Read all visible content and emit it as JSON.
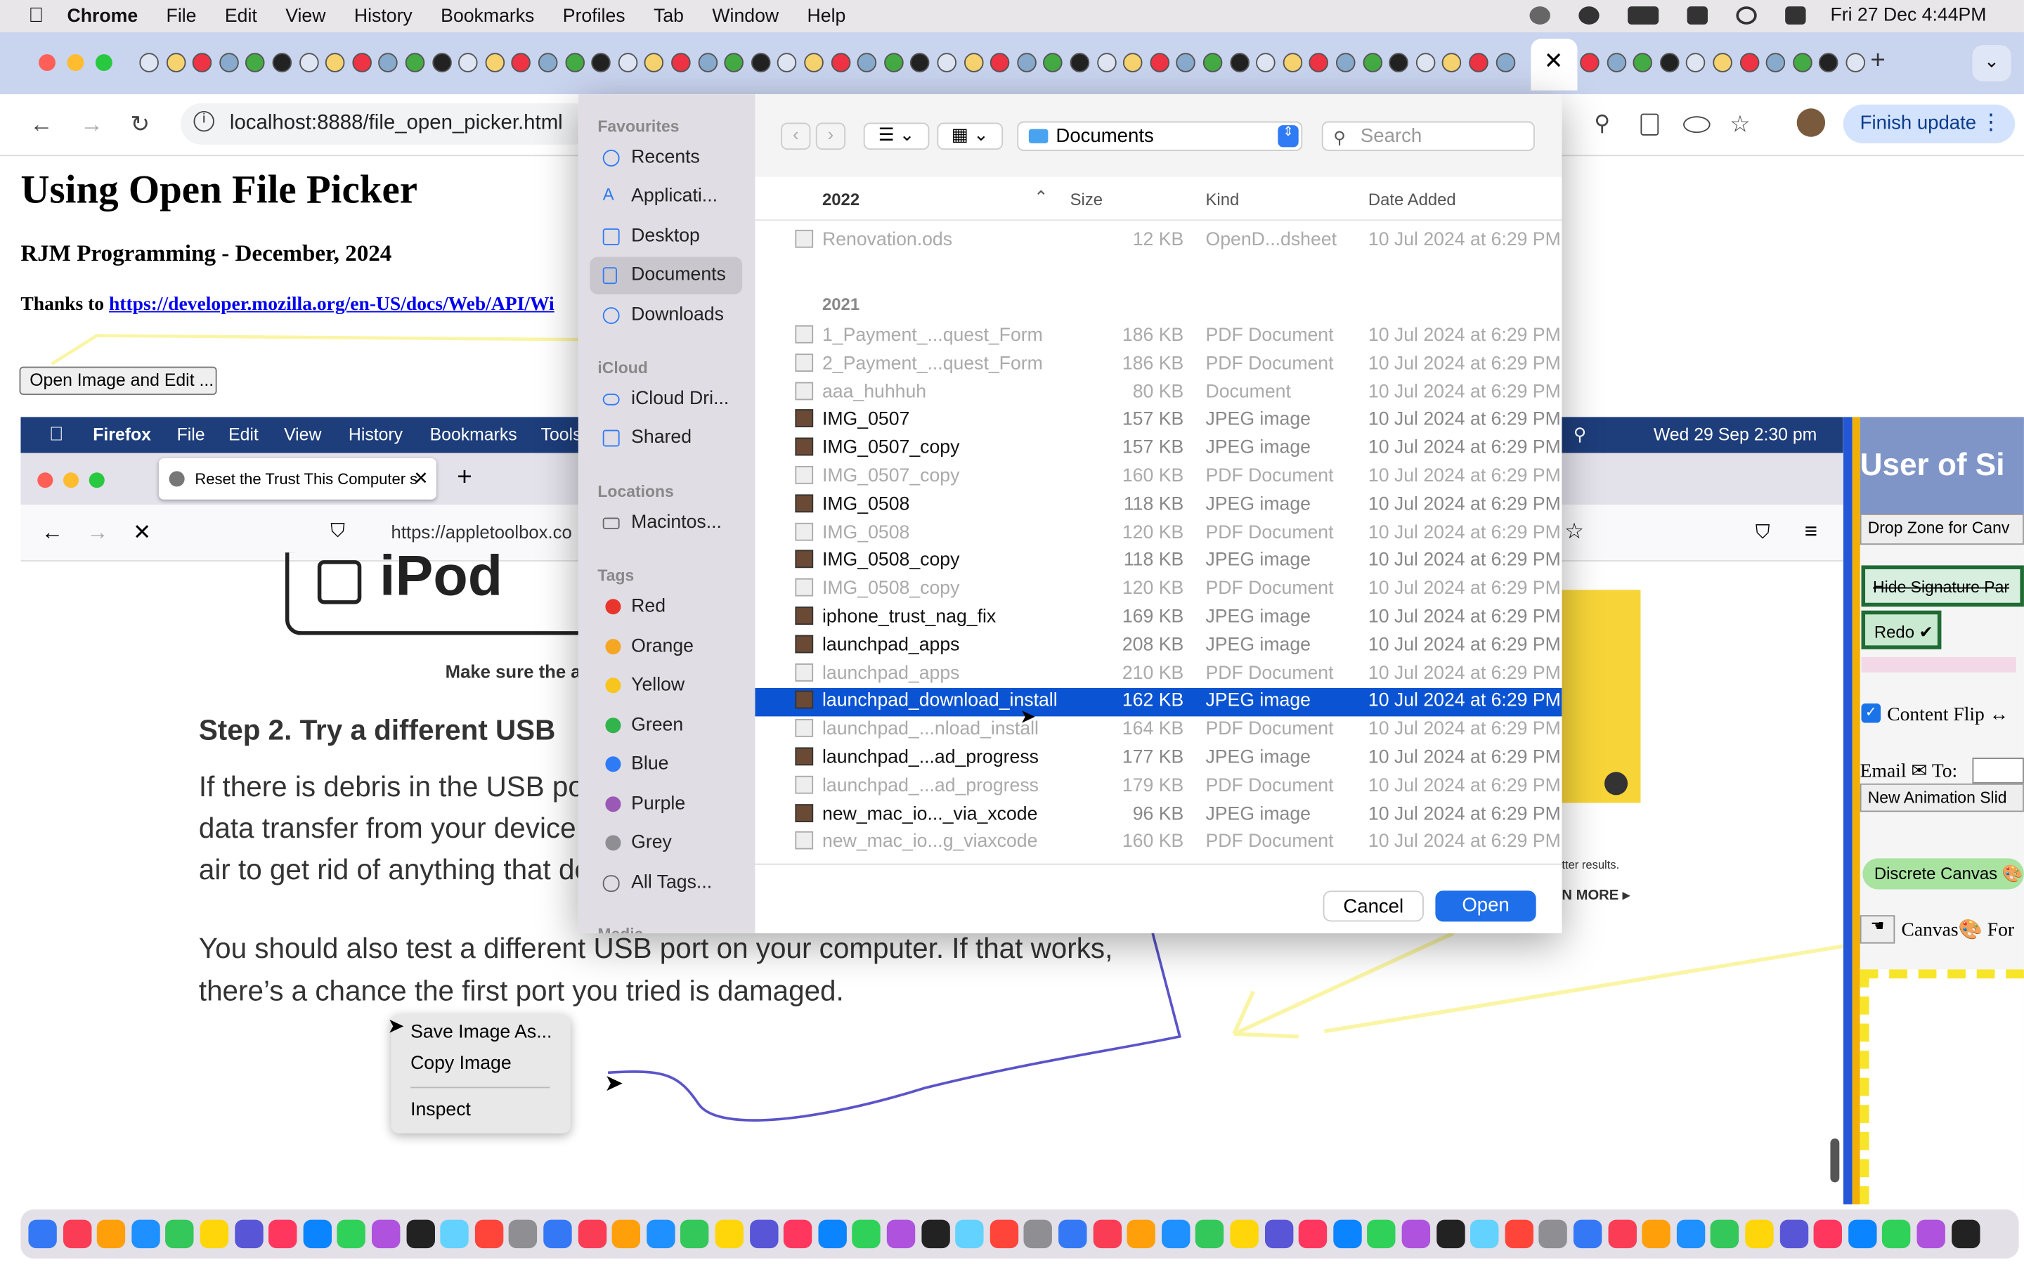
{
  "menubar": {
    "app": "Chrome",
    "items": [
      "File",
      "Edit",
      "View",
      "History",
      "Bookmarks",
      "Profiles",
      "Tab",
      "Window",
      "Help"
    ],
    "datetime": "Fri 27 Dec  4:44PM"
  },
  "browser": {
    "url": "localhost:8888/file_open_picker.html",
    "finish_update": "Finish update"
  },
  "page": {
    "title": "Using Open File Picker",
    "subtitle": "RJM Programming - December, 2024",
    "thanks_prefix": "Thanks to ",
    "thanks_link": "https://developer.mozilla.org/en-US/docs/Web/API/Wi",
    "open_button": "Open Image and Edit ..."
  },
  "embedded": {
    "menubar": {
      "app": "Firefox",
      "items": [
        "File",
        "Edit",
        "View",
        "History",
        "Bookmarks",
        "Tools"
      ],
      "datetime": "Wed 29 Sep  2:30 pm"
    },
    "tab_title": "Reset the Trust This Computer s",
    "url": "https://appletoolbox.co",
    "ipod_text": "iPod",
    "caption": "Make sure the a",
    "step_heading": "Step 2. Try a different USB",
    "para1": [
      "If there is debris in the USB port",
      "data transfer from your device. S",
      "air to get rid of anything that doe"
    ],
    "para2": [
      "You should also test a different USB port on your computer. If that works,",
      "there’s a chance the first port you tried is damaged."
    ],
    "context_menu": [
      "Save Image As...",
      "Copy Image",
      "Inspect"
    ],
    "side_text": [
      "tter results.",
      "N MORE ▸"
    ],
    "right_panel": {
      "title": "User of Si",
      "drop_zone": "Drop Zone for Canv",
      "hide_sig": "Hide Signature Par",
      "redo": "Redo ✔",
      "content_flip": "Content Flip ↔",
      "email_label": "Email ✉ To:",
      "new_anim": "New Animation Slid",
      "discrete": "Discrete Canvas 🎨",
      "canvas_for": "Canvas🎨 For"
    }
  },
  "dialog": {
    "location": "Documents",
    "search_placeholder": "Search",
    "sidebar": {
      "favourites_label": "Favourites",
      "favourites": [
        "Recents",
        "Applicati...",
        "Desktop",
        "Documents",
        "Downloads"
      ],
      "icloud_label": "iCloud",
      "icloud": [
        "iCloud Dri...",
        "Shared"
      ],
      "locations_label": "Locations",
      "locations": [
        "Macintos..."
      ],
      "tags_label": "Tags",
      "tags": [
        {
          "name": "Red",
          "color": "#e8362e"
        },
        {
          "name": "Orange",
          "color": "#f5a623"
        },
        {
          "name": "Yellow",
          "color": "#f7c51e"
        },
        {
          "name": "Green",
          "color": "#31b44b"
        },
        {
          "name": "Blue",
          "color": "#2f7bf5"
        },
        {
          "name": "Purple",
          "color": "#9b59b6"
        },
        {
          "name": "Grey",
          "color": "#8e8e93"
        }
      ],
      "all_tags": "All Tags...",
      "media_label": "Media"
    },
    "columns": [
      "2022",
      "Size",
      "Kind",
      "Date Added"
    ],
    "group_2021": "2021",
    "files": [
      {
        "name": "Renovation.ods",
        "size": "12 KB",
        "kind": "OpenD...dsheet",
        "date": "10 Jul 2024 at 6:29 PM",
        "dim": true
      },
      {
        "name": "1_Payment_...quest_Form",
        "size": "186 KB",
        "kind": "PDF Document",
        "date": "10 Jul 2024 at 6:29 PM",
        "dim": true
      },
      {
        "name": "2_Payment_...quest_Form",
        "size": "186 KB",
        "kind": "PDF Document",
        "date": "10 Jul 2024 at 6:29 PM",
        "dim": true
      },
      {
        "name": "aaa_huhhuh",
        "size": "80 KB",
        "kind": "Document",
        "date": "10 Jul 2024 at 6:29 PM",
        "dim": true
      },
      {
        "name": "IMG_0507",
        "size": "157 KB",
        "kind": "JPEG image",
        "date": "10 Jul 2024 at 6:29 PM",
        "dim": false
      },
      {
        "name": "IMG_0507_copy",
        "size": "157 KB",
        "kind": "JPEG image",
        "date": "10 Jul 2024 at 6:29 PM",
        "dim": false
      },
      {
        "name": "IMG_0507_copy",
        "size": "160 KB",
        "kind": "PDF Document",
        "date": "10 Jul 2024 at 6:29 PM",
        "dim": true
      },
      {
        "name": "IMG_0508",
        "size": "118 KB",
        "kind": "JPEG image",
        "date": "10 Jul 2024 at 6:29 PM",
        "dim": false
      },
      {
        "name": "IMG_0508",
        "size": "120 KB",
        "kind": "PDF Document",
        "date": "10 Jul 2024 at 6:29 PM",
        "dim": true
      },
      {
        "name": "IMG_0508_copy",
        "size": "118 KB",
        "kind": "JPEG image",
        "date": "10 Jul 2024 at 6:29 PM",
        "dim": false
      },
      {
        "name": "IMG_0508_copy",
        "size": "120 KB",
        "kind": "PDF Document",
        "date": "10 Jul 2024 at 6:29 PM",
        "dim": true
      },
      {
        "name": "iphone_trust_nag_fix",
        "size": "169 KB",
        "kind": "JPEG image",
        "date": "10 Jul 2024 at 6:29 PM",
        "dim": false
      },
      {
        "name": "launchpad_apps",
        "size": "208 KB",
        "kind": "JPEG image",
        "date": "10 Jul 2024 at 6:29 PM",
        "dim": false
      },
      {
        "name": "launchpad_apps",
        "size": "210 KB",
        "kind": "PDF Document",
        "date": "10 Jul 2024 at 6:29 PM",
        "dim": true
      },
      {
        "name": "launchpad_download_install",
        "size": "162 KB",
        "kind": "JPEG image",
        "date": "10 Jul 2024 at 6:29 PM",
        "dim": false,
        "selected": true
      },
      {
        "name": "launchpad_...nload_install",
        "size": "164 KB",
        "kind": "PDF Document",
        "date": "10 Jul 2024 at 6:29 PM",
        "dim": true
      },
      {
        "name": "launchpad_...ad_progress",
        "size": "177 KB",
        "kind": "JPEG image",
        "date": "10 Jul 2024 at 6:29 PM",
        "dim": false
      },
      {
        "name": "launchpad_...ad_progress",
        "size": "179 KB",
        "kind": "PDF Document",
        "date": "10 Jul 2024 at 6:29 PM",
        "dim": true
      },
      {
        "name": "new_mac_io..._via_xcode",
        "size": "96 KB",
        "kind": "JPEG image",
        "date": "10 Jul 2024 at 6:29 PM",
        "dim": false
      },
      {
        "name": "new_mac_io...g_viaxcode",
        "size": "160 KB",
        "kind": "PDF Document",
        "date": "10 Jul 2024 at 6:29 PM",
        "dim": true
      }
    ],
    "cancel": "Cancel",
    "open": "Open"
  }
}
